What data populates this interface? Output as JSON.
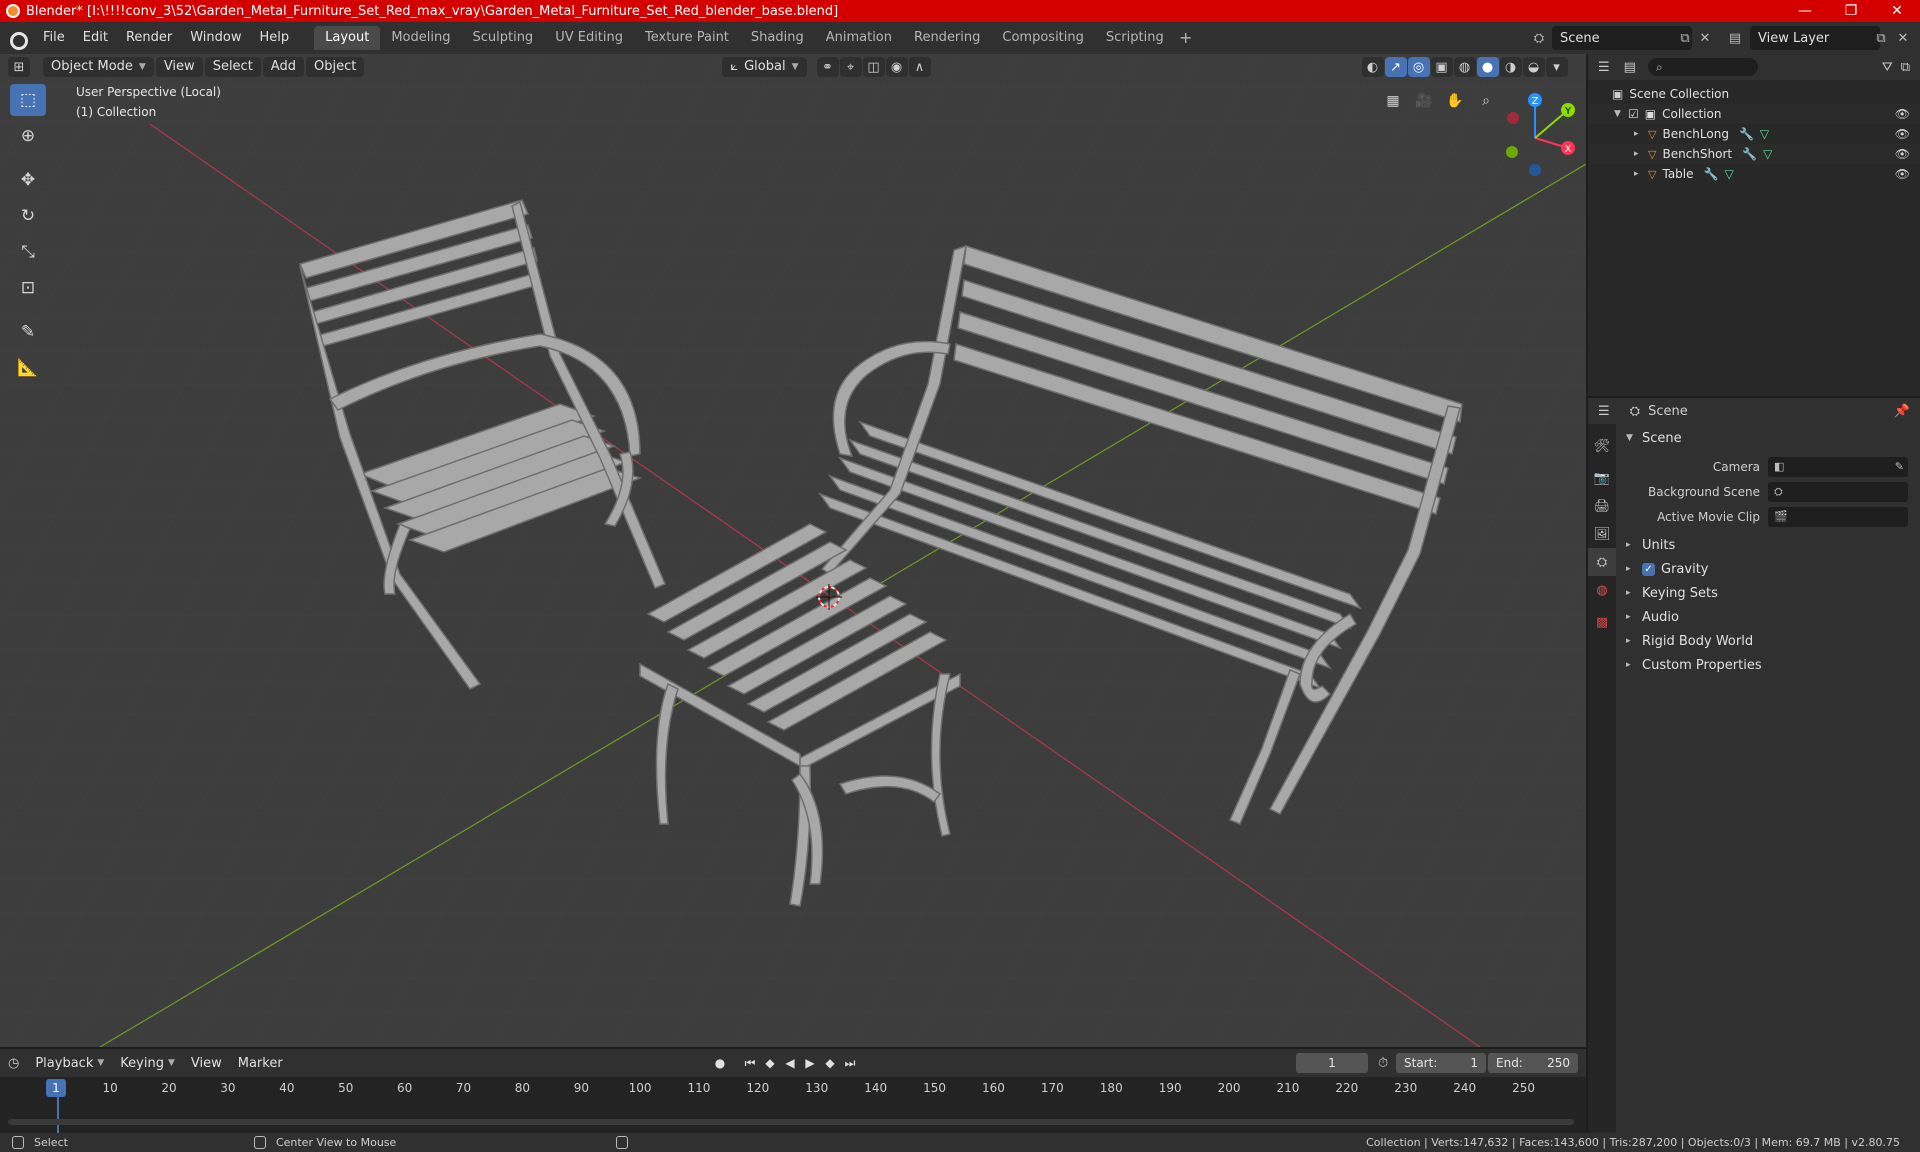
{
  "window": {
    "title": "Blender* [I:\\!!!!conv_3\\52\\Garden_Metal_Furniture_Set_Red_max_vray\\Garden_Metal_Furniture_Set_Red_blender_base.blend]",
    "minimize": "—",
    "maximize": "❐",
    "close": "✕"
  },
  "menu": [
    "File",
    "Edit",
    "Render",
    "Window",
    "Help"
  ],
  "workspaces": [
    "Layout",
    "Modeling",
    "Sculpting",
    "UV Editing",
    "Texture Paint",
    "Shading",
    "Animation",
    "Rendering",
    "Compositing",
    "Scripting"
  ],
  "active_workspace": "Layout",
  "scene_name": "Scene",
  "view_layer_name": "View Layer",
  "viewport": {
    "mode": "Object Mode",
    "menus": [
      "View",
      "Select",
      "Add",
      "Object"
    ],
    "orientation": "Global",
    "overlay_line1": "User Perspective (Local)",
    "overlay_line2": "(1) Collection",
    "gizmo": {
      "x": "X",
      "y": "Y",
      "z": "Z"
    }
  },
  "outliner": {
    "root": "Scene Collection",
    "collection": "Collection",
    "objects": [
      "BenchLong",
      "BenchShort",
      "Table"
    ]
  },
  "properties": {
    "header": "Scene",
    "section": "Scene",
    "fields": [
      {
        "label": "Camera",
        "value": ""
      },
      {
        "label": "Background Scene",
        "value": ""
      },
      {
        "label": "Active Movie Clip",
        "value": ""
      }
    ],
    "panels": [
      "Units",
      "Gravity",
      "Keying Sets",
      "Audio",
      "Rigid Body World",
      "Custom Properties"
    ]
  },
  "timeline": {
    "menus": [
      "Playback",
      "Keying",
      "View",
      "Marker"
    ],
    "current_frame": "1",
    "start_label": "Start:",
    "start": "1",
    "end_label": "End:",
    "end": "250",
    "ruler": [
      "1",
      "10",
      "20",
      "30",
      "40",
      "50",
      "60",
      "70",
      "80",
      "90",
      "100",
      "110",
      "120",
      "130",
      "140",
      "150",
      "160",
      "170",
      "180",
      "190",
      "200",
      "210",
      "220",
      "230",
      "240",
      "250"
    ]
  },
  "status": {
    "left1": "Select",
    "left2": "Center View to Mouse",
    "right": "Collection | Verts:147,632 | Faces:143,600 | Tris:287,200 | Objects:0/3 | Mem: 69.7 MB | v2.80.75"
  },
  "colors": {
    "accent": "#4772b3",
    "titlebar": "#d40000",
    "object_icon": "#ec8c2c",
    "axis_x": "#ff3352",
    "axis_y": "#8bdc00",
    "axis_z": "#2890ff"
  }
}
